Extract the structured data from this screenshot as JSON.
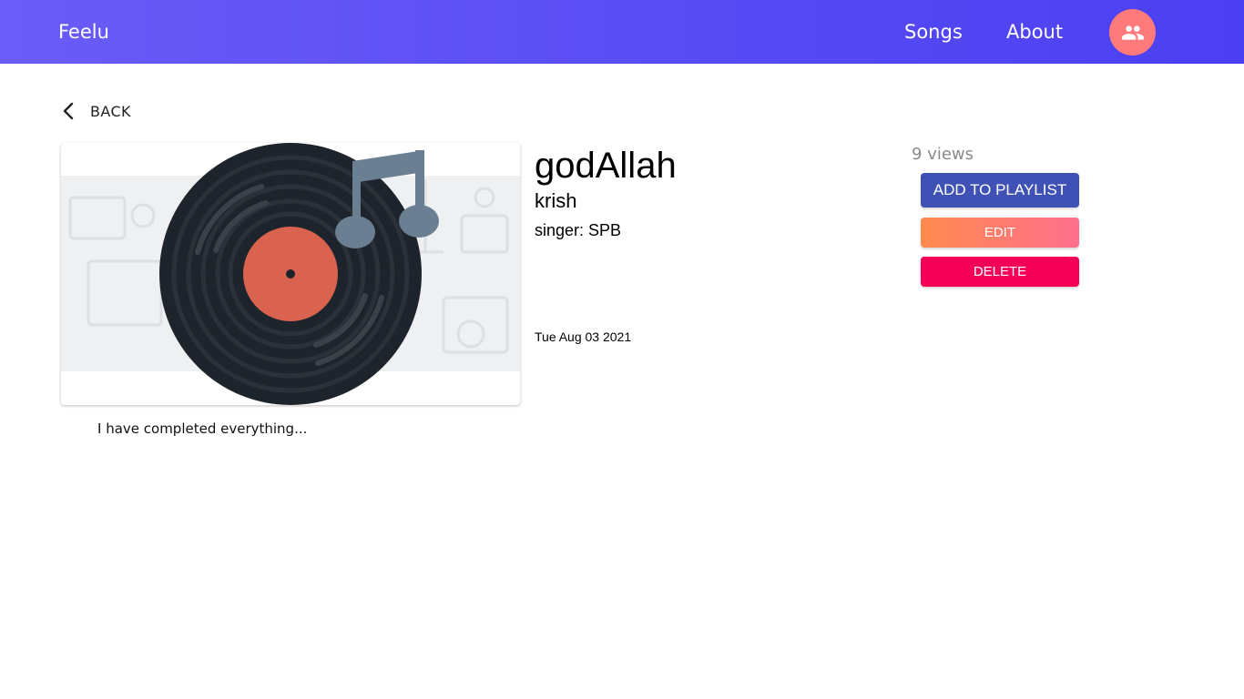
{
  "navbar": {
    "brand": "Feelu",
    "links": [
      "Songs",
      "About"
    ],
    "avatar_icon": "people-icon",
    "gradient": [
      "#6a5cf6",
      "#4b3ff2"
    ],
    "avatar_color": "#ff7b7b"
  },
  "back": {
    "label": "BACK",
    "icon": "chevron-left-icon"
  },
  "song": {
    "title": "godAllah",
    "artist": "krish",
    "singer": "singer: SPB",
    "date": "Tue Aug 03 2021",
    "description": "I have completed everything...",
    "views": "9 views",
    "cover_icon": "vinyl-record-music-note-icon"
  },
  "actions": {
    "add_to_playlist": "ADD TO PLAYLIST",
    "edit": "EDIT",
    "delete": "DELETE",
    "colors": {
      "playlist": "#3f51b5",
      "edit": "#ff8a4c",
      "delete": "#f50057"
    }
  }
}
